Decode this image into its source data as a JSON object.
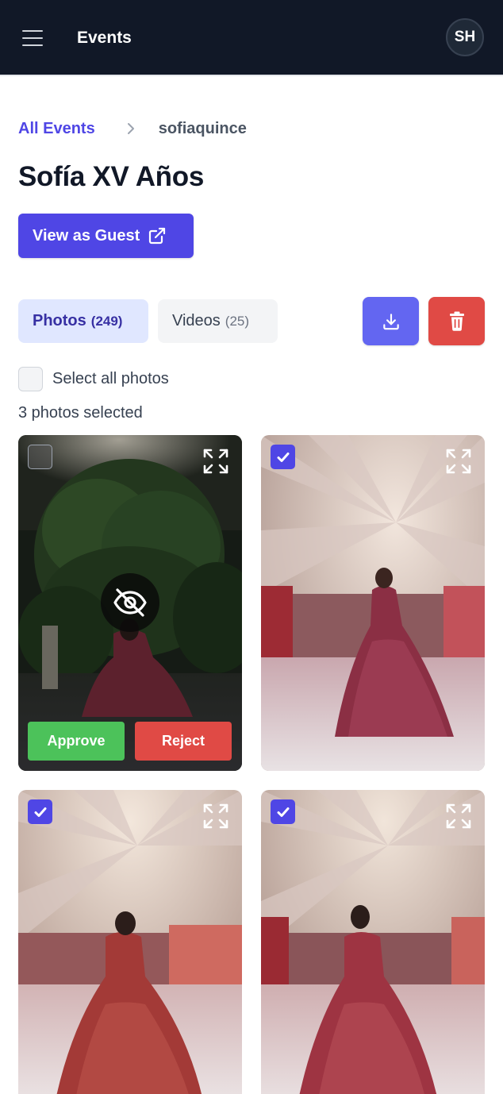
{
  "header": {
    "title": "Events",
    "user_initials": "SH"
  },
  "breadcrumb": {
    "root": "All Events",
    "current": "sofiaquince"
  },
  "event": {
    "title": "Sofía XV Años",
    "view_as_guest_label": "View as Guest"
  },
  "tabs": [
    {
      "label": "Photos",
      "count": "(249)",
      "active": true
    },
    {
      "label": "Videos",
      "count": "(25)",
      "active": false
    }
  ],
  "actions": {
    "download_icon": "download-icon",
    "delete_icon": "trash-icon"
  },
  "selection": {
    "select_all_label": "Select all photos",
    "selected_text": "3 photos selected"
  },
  "photos": [
    {
      "selected": false,
      "hidden": true,
      "approve_label": "Approve",
      "reject_label": "Reject"
    },
    {
      "selected": true,
      "hidden": false
    },
    {
      "selected": true,
      "hidden": false
    },
    {
      "selected": true,
      "hidden": false
    }
  ],
  "colors": {
    "nav_bg": "#111827",
    "primary": "#4f46e5",
    "danger": "#e04a45",
    "success": "#4cc25a",
    "tab_active_bg": "#e0e7ff"
  }
}
